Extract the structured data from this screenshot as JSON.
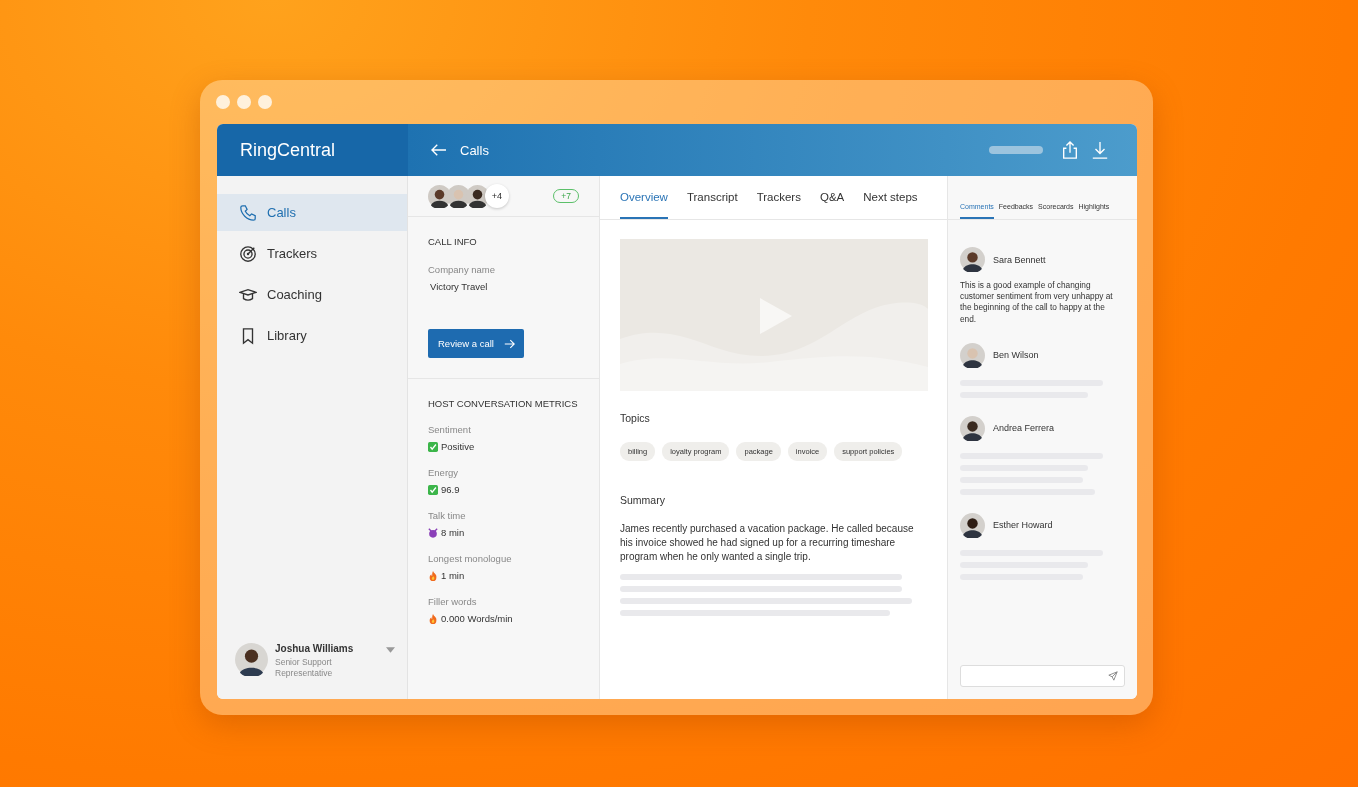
{
  "brand": "RingCentral",
  "header": {
    "title": "Calls"
  },
  "nav": [
    {
      "label": "Calls",
      "kind": "phone",
      "selected": true
    },
    {
      "label": "Trackers",
      "kind": "target",
      "selected": false
    },
    {
      "label": "Coaching",
      "kind": "cap",
      "selected": false
    },
    {
      "label": "Library",
      "kind": "bookmark",
      "selected": false
    }
  ],
  "user": {
    "name": "Joshua Williams",
    "role": "Senior Support Representative"
  },
  "participants": {
    "more": "+4",
    "badge": "+7"
  },
  "call_info": {
    "heading": "CALL INFO",
    "fields": [
      {
        "label": "Company name",
        "value": "Victory Travel"
      }
    ],
    "button": "Review a call"
  },
  "metrics": {
    "heading": "HOST CONVERSATION METRICS",
    "items": [
      {
        "label": "Sentiment",
        "value": "Positive",
        "kind": "check"
      },
      {
        "label": "Energy",
        "value": "96.9",
        "kind": "check"
      },
      {
        "label": "Talk time",
        "value": "8 min",
        "kind": "devil"
      },
      {
        "label": "Longest monologue",
        "value": "1 min",
        "kind": "fire"
      },
      {
        "label": "Filler words",
        "value": "0.000 Words/min",
        "kind": "fire"
      }
    ]
  },
  "tabs": [
    {
      "label": "Overview",
      "selected": true
    },
    {
      "label": "Transcript",
      "selected": false
    },
    {
      "label": "Trackers",
      "selected": false
    },
    {
      "label": "Q&A",
      "selected": false
    },
    {
      "label": "Next steps",
      "selected": false
    }
  ],
  "topics": {
    "heading": "Topics",
    "tags": [
      "billing",
      "loyalty program",
      "package",
      "invoice",
      "support policies"
    ]
  },
  "summary": {
    "heading": "Summary",
    "text": "James recently purchased a vacation package. He called because his invoice showed he had signed up for a recurring timeshare program when he only wanted a single trip."
  },
  "side_tabs": [
    {
      "label": "Comments",
      "selected": true
    },
    {
      "label": "Feedbacks",
      "selected": false
    },
    {
      "label": "Scorecards",
      "selected": false
    },
    {
      "label": "Highlights",
      "selected": false
    }
  ],
  "comments": [
    {
      "author": "Sara Bennett",
      "text": "This is a good example of changing customer sentiment from very unhappy at the beginning of the call to happy at the end."
    },
    {
      "author": "Ben Wilson"
    },
    {
      "author": "Andrea Ferrera"
    },
    {
      "author": "Esther Howard"
    }
  ]
}
